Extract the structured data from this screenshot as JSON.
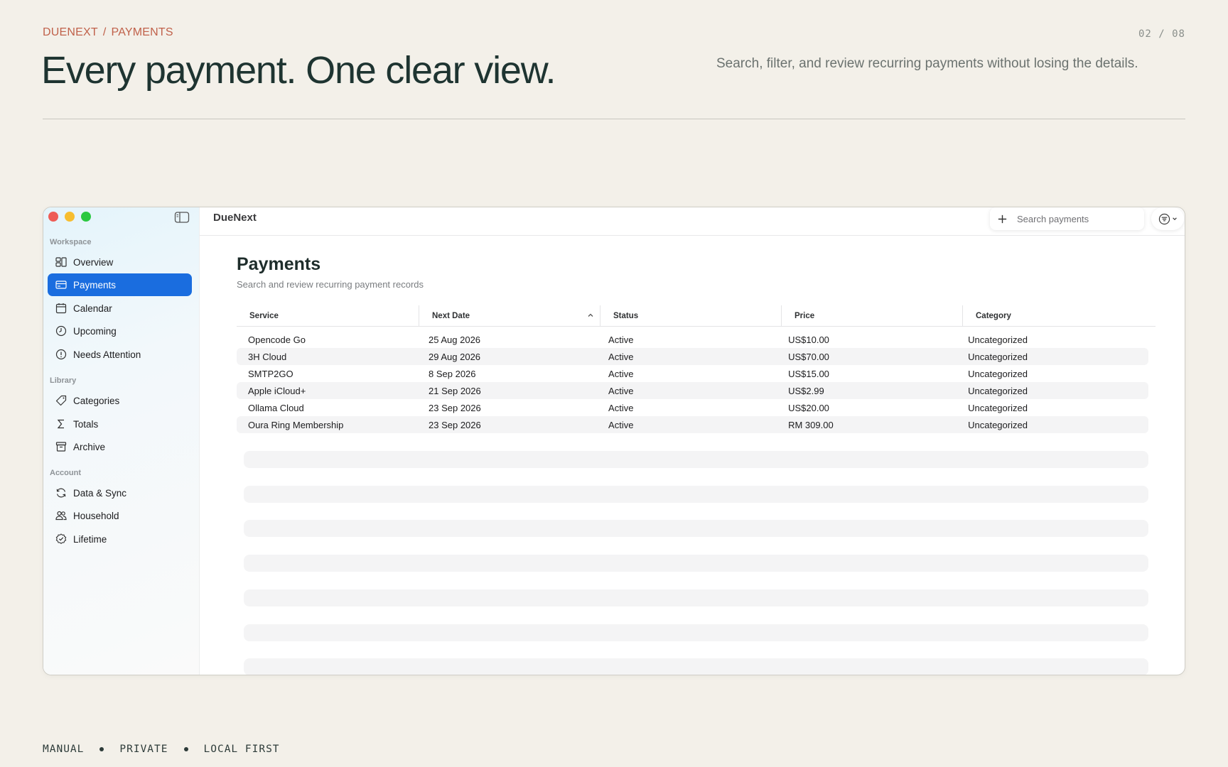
{
  "slide": {
    "breadcrumb_brand": "DUENEXT",
    "breadcrumb_sep": "/",
    "breadcrumb_section": "PAYMENTS",
    "page_indicator": "02 / 08",
    "title": "Every payment. One clear view.",
    "subtitle": "Search, filter, and review recurring payments without losing the details.",
    "footer": [
      "MANUAL",
      "PRIVATE",
      "LOCAL FIRST"
    ]
  },
  "app": {
    "name": "DueNext",
    "search_placeholder": "Search payments",
    "accent_color": "#1a6ddf"
  },
  "sidebar": {
    "sections": [
      {
        "label": "Workspace",
        "items": [
          {
            "label": "Overview",
            "icon": "overview-icon"
          },
          {
            "label": "Payments",
            "icon": "card-icon",
            "active": true
          },
          {
            "label": "Calendar",
            "icon": "calendar-icon"
          },
          {
            "label": "Upcoming",
            "icon": "clock-icon"
          },
          {
            "label": "Needs Attention",
            "icon": "alert-icon"
          }
        ]
      },
      {
        "label": "Library",
        "items": [
          {
            "label": "Categories",
            "icon": "tag-icon"
          },
          {
            "label": "Totals",
            "icon": "sigma-icon"
          },
          {
            "label": "Archive",
            "icon": "archive-icon"
          }
        ]
      },
      {
        "label": "Account",
        "items": [
          {
            "label": "Data & Sync",
            "icon": "sync-icon"
          },
          {
            "label": "Household",
            "icon": "people-icon"
          },
          {
            "label": "Lifetime",
            "icon": "badge-check-icon"
          }
        ]
      }
    ]
  },
  "payments": {
    "title": "Payments",
    "subtitle": "Search and review recurring payment records",
    "columns": [
      "Service",
      "Next Date",
      "Status",
      "Price",
      "Category"
    ],
    "sorted_column": "Next Date",
    "sort_direction": "ascending",
    "rows": [
      [
        "Opencode Go",
        "25 Aug 2026",
        "Active",
        "US$10.00",
        "Uncategorized"
      ],
      [
        "3H Cloud",
        "29 Aug 2026",
        "Active",
        "US$70.00",
        "Uncategorized"
      ],
      [
        "SMTP2GO",
        "8 Sep 2026",
        "Active",
        "US$15.00",
        "Uncategorized"
      ],
      [
        "Apple iCloud+",
        "21 Sep 2026",
        "Active",
        "US$2.99",
        "Uncategorized"
      ],
      [
        "Ollama Cloud",
        "23 Sep 2026",
        "Active",
        "US$20.00",
        "Uncategorized"
      ],
      [
        "Oura Ring Membership",
        "23 Sep 2026",
        "Active",
        "RM 309.00",
        "Uncategorized"
      ]
    ]
  }
}
